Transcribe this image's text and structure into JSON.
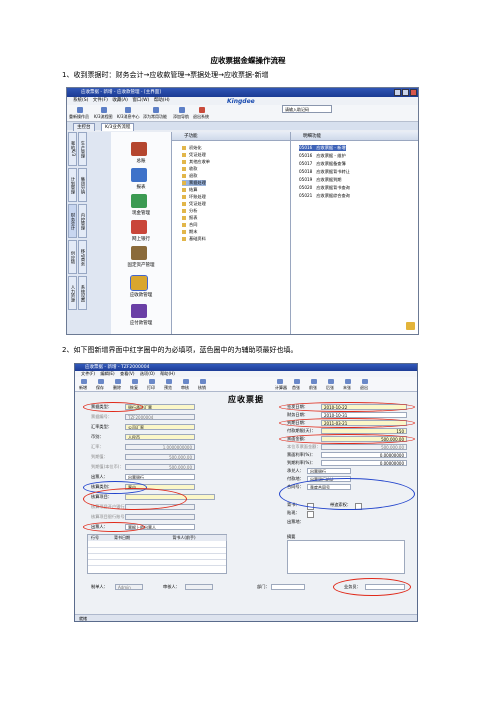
{
  "document": {
    "title": "应收票据金蝶操作流程",
    "step1": "1、收到票据时：财务会计→应收款管理→票据处理→应收票据-新增",
    "step2": "2、如下图新增界面中红字圈中的为必填项，蓝色圈中的为辅助项最好也填。"
  },
  "shot1": {
    "title": "应收票据 - 新增 - 应收款管理 - [主界面]",
    "menu": "系统(S)  文件(F)  收藏(A)  窗口(W)  帮助(H)",
    "logo": "Kingdee",
    "toolbar": [
      "重新操作员",
      "K/3流程图",
      "K/3消息中心",
      "添为常用功能",
      "添加导航",
      "退出系统"
    ],
    "search_placeholder": "请输入助记码",
    "tabs": [
      "主控台",
      "K/3业务流程"
    ],
    "vertical_nav": [
      "我的K/3",
      "计划管理",
      "财务会计",
      "供应链",
      "人力资源",
      "生产管理",
      "集团分销",
      "内控管理",
      "移动商务",
      "系统设置"
    ],
    "modules": [
      "总账",
      "报表",
      "现金管理",
      "网上银行",
      "固定资产管理",
      "应收款管理",
      "应付款管理"
    ],
    "sub_header": "子功能",
    "sub_items": [
      "初始化",
      "凭证处理",
      "其他应收单",
      "收款",
      "退款",
      "票据处理",
      "结算",
      "坏账处理",
      "凭证处理",
      "分析",
      "报表",
      "合同",
      "期末",
      "基础资料"
    ],
    "sub_selected_index": 5,
    "detail_header": "明细功能",
    "detail_items": [
      {
        "code": "05016",
        "name": "应收票据 - 新增"
      },
      {
        "code": "05016",
        "name": "应收票据 - 维护"
      },
      {
        "code": "05017",
        "name": "应收票据备查簿"
      },
      {
        "code": "05018",
        "name": "应收票据背书转让"
      },
      {
        "code": "05019",
        "name": "应收票据到期"
      },
      {
        "code": "05020",
        "name": "应收票据背书查询"
      },
      {
        "code": "05021",
        "name": "应收票据综合查询"
      }
    ],
    "detail_selected_index": 0
  },
  "shot2": {
    "title": "应收票据 - 新增 - TZF2000004",
    "menu": "文件(F)  编辑(E)  查看(V)  选项(O)  帮助(H)",
    "toolbar": [
      "新增",
      "保存",
      "删除",
      "恢复",
      "打印",
      "预览",
      "审核",
      "核销",
      "计算器",
      "首张",
      "前张",
      "后张",
      "末张",
      "退出"
    ],
    "form_title": "应收票据",
    "left_fields": [
      {
        "label": "票据类型：",
        "value": "银行承兑汇票"
      },
      {
        "label": "票据编号：",
        "value": "TZF2000004"
      },
      {
        "label": "汇率类型：",
        "value": "公司汇率"
      },
      {
        "label": "币别：",
        "value": "人民币"
      },
      {
        "label": "汇率：",
        "value": "1.0000000000"
      },
      {
        "label": "到期值：",
        "value": "500,000.00"
      },
      {
        "label": "到期值(本位币)：",
        "value": "500,000.00"
      },
      {
        "label": "出票人：",
        "value": "出票银行"
      },
      {
        "label": "核算类别：",
        "value": "客户"
      },
      {
        "label": "核算项目：",
        "value": ""
      },
      {
        "label": "核算项目开户银行：",
        "value": ""
      },
      {
        "label": "核算项目银行账号：",
        "value": ""
      },
      {
        "label": "出票人：",
        "value": "票据上的出票人"
      }
    ],
    "right_fields": [
      {
        "label": "签发日期：",
        "value": "2010-10-22"
      },
      {
        "label": "财务日期：",
        "value": "2010-10-31"
      },
      {
        "label": "到期日期：",
        "value": "2011-03-21"
      },
      {
        "label": "付款期限(天)：",
        "value": "150"
      },
      {
        "label": "票面金额：",
        "value": "500,000.00"
      },
      {
        "label": "本位币票面金额：",
        "value": "500,000.00"
      },
      {
        "label": "票面利率(%)：",
        "value": "0.00000000"
      },
      {
        "label": "到期利率(%)：",
        "value": "0.00000000"
      },
      {
        "label": "承兑人：",
        "value": "出票银行"
      },
      {
        "label": "付款地：",
        "value": "出票银行地址"
      },
      {
        "label": "合同号：",
        "value": "季度合同号"
      }
    ],
    "checks": [
      "背书：",
      "带追索权：",
      "贴现："
    ],
    "drawer_label": "出票地：",
    "memo_label": "摘要",
    "grid_headers": [
      "行号",
      "背书日期",
      "背书人(前手)"
    ],
    "bottom": {
      "maker": "制单人：",
      "maker_value": "Admin",
      "reviewer": "审核人：",
      "dept": "部门：",
      "salesman": "业务员："
    },
    "status": "就绪"
  }
}
